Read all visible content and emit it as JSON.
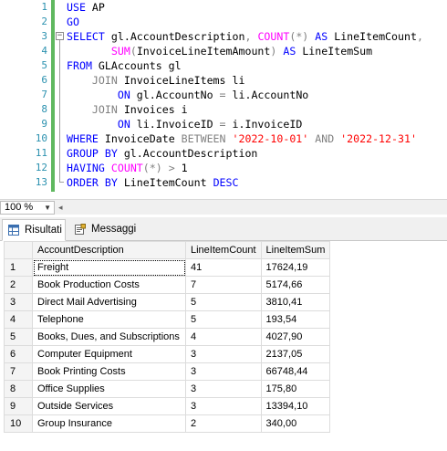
{
  "editor": {
    "line_numbers": [
      "1",
      "2",
      "3",
      "4",
      "5",
      "6",
      "7",
      "8",
      "9",
      "10",
      "11",
      "12",
      "13"
    ],
    "lines": [
      [
        {
          "t": "USE ",
          "c": "kw"
        },
        {
          "t": "AP",
          "c": ""
        }
      ],
      [
        {
          "t": "GO",
          "c": "kw"
        }
      ],
      [
        {
          "t": "SELECT ",
          "c": "kw"
        },
        {
          "t": "gl.AccountDescription",
          "c": ""
        },
        {
          "t": ", ",
          "c": "gr"
        },
        {
          "t": "COUNT",
          "c": "fn"
        },
        {
          "t": "(*) ",
          "c": "gr"
        },
        {
          "t": "AS ",
          "c": "kw"
        },
        {
          "t": "LineItemCount",
          "c": ""
        },
        {
          "t": ",",
          "c": "gr"
        }
      ],
      [
        {
          "t": "       ",
          "c": ""
        },
        {
          "t": "SUM",
          "c": "fn"
        },
        {
          "t": "(",
          "c": "gr"
        },
        {
          "t": "InvoiceLineItemAmount",
          "c": ""
        },
        {
          "t": ") ",
          "c": "gr"
        },
        {
          "t": "AS ",
          "c": "kw"
        },
        {
          "t": "LineItemSum",
          "c": ""
        }
      ],
      [
        {
          "t": "FROM ",
          "c": "kw"
        },
        {
          "t": "GLAccounts gl",
          "c": ""
        }
      ],
      [
        {
          "t": "    ",
          "c": ""
        },
        {
          "t": "JOIN ",
          "c": "gr"
        },
        {
          "t": "InvoiceLineItems li",
          "c": ""
        }
      ],
      [
        {
          "t": "        ",
          "c": ""
        },
        {
          "t": "ON ",
          "c": "kw"
        },
        {
          "t": "gl.AccountNo ",
          "c": ""
        },
        {
          "t": "= ",
          "c": "gr"
        },
        {
          "t": "li.AccountNo",
          "c": ""
        }
      ],
      [
        {
          "t": "    ",
          "c": ""
        },
        {
          "t": "JOIN ",
          "c": "gr"
        },
        {
          "t": "Invoices i",
          "c": ""
        }
      ],
      [
        {
          "t": "        ",
          "c": ""
        },
        {
          "t": "ON ",
          "c": "kw"
        },
        {
          "t": "li.InvoiceID ",
          "c": ""
        },
        {
          "t": "= ",
          "c": "gr"
        },
        {
          "t": "i.InvoiceID",
          "c": ""
        }
      ],
      [
        {
          "t": "WHERE ",
          "c": "kw"
        },
        {
          "t": "InvoiceDate ",
          "c": ""
        },
        {
          "t": "BETWEEN ",
          "c": "gr"
        },
        {
          "t": "'2022-10-01' ",
          "c": "st"
        },
        {
          "t": "AND ",
          "c": "gr"
        },
        {
          "t": "'2022-12-31'",
          "c": "st"
        }
      ],
      [
        {
          "t": "GROUP BY ",
          "c": "kw"
        },
        {
          "t": "gl.AccountDescription",
          "c": ""
        }
      ],
      [
        {
          "t": "HAVING ",
          "c": "kw"
        },
        {
          "t": "COUNT",
          "c": "fn"
        },
        {
          "t": "(*) ",
          "c": "gr"
        },
        {
          "t": "> ",
          "c": "gr"
        },
        {
          "t": "1",
          "c": ""
        }
      ],
      [
        {
          "t": "ORDER BY ",
          "c": "kw"
        },
        {
          "t": "LineItemCount ",
          "c": ""
        },
        {
          "t": "DESC",
          "c": "kw"
        }
      ]
    ]
  },
  "zoom": {
    "value": "100 %"
  },
  "tabs": {
    "results": "Risultati",
    "messages": "Messaggi"
  },
  "grid": {
    "columns": [
      "AccountDescription",
      "LineItemCount",
      "LineItemSum"
    ],
    "rows": [
      [
        "1",
        "Freight",
        "41",
        "17624,19"
      ],
      [
        "2",
        "Book Production Costs",
        "7",
        "5174,66"
      ],
      [
        "3",
        "Direct Mail Advertising",
        "5",
        "3810,41"
      ],
      [
        "4",
        "Telephone",
        "5",
        "193,54"
      ],
      [
        "5",
        "Books, Dues, and Subscriptions",
        "4",
        "4027,90"
      ],
      [
        "6",
        "Computer Equipment",
        "3",
        "2137,05"
      ],
      [
        "7",
        "Book Printing Costs",
        "3",
        "66748,44"
      ],
      [
        "8",
        "Office Supplies",
        "3",
        "175,80"
      ],
      [
        "9",
        "Outside Services",
        "3",
        "13394,10"
      ],
      [
        "10",
        "Group Insurance",
        "2",
        "340,00"
      ]
    ]
  },
  "colors": {
    "keyword": "#0000ff",
    "function": "#ff00ff",
    "string": "#ff0000",
    "operator": "#808080",
    "line_number": "#2b91af",
    "change_bar": "#5fb85f"
  },
  "icons": {
    "results": "grid-icon",
    "messages": "messages-icon"
  }
}
